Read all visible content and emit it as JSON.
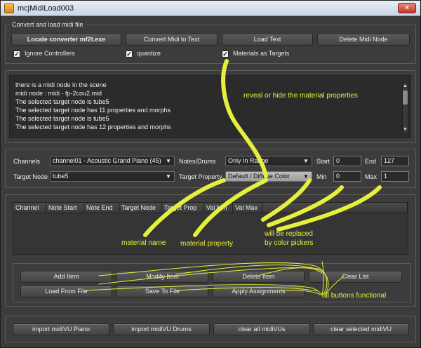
{
  "window": {
    "title": "mcjMidiLoad003",
    "close_glyph": "×"
  },
  "load_group": {
    "label": "Convert and load midi file",
    "buttons": [
      "Locate converter mf2t.exe",
      "Convert Midi to Text",
      "Load Text",
      "Delete Midi Node"
    ],
    "checkboxes": [
      {
        "label": "Ignore Controllers",
        "checked": true
      },
      {
        "label": "quantize",
        "checked": true
      },
      {
        "label": "Materials as Targets",
        "checked": true
      }
    ]
  },
  "log": {
    "lines": [
      "there is a midi node in the scene",
      "midi node : midi - fp-2cou2.mid",
      "The selected target node is tube5",
      "The selected target node has 11 properties and morphs",
      "The selected target node is tube5",
      "The selected target node has 12 properties and morphs"
    ]
  },
  "settings": {
    "channels_label": "Channels",
    "channels_value": "channel01 - Acoustic Grand Piano (45)",
    "notes_label": "Notes/Drums",
    "notes_value": "Only In Range",
    "start_label": "Start",
    "start_value": "0",
    "end_label": "End",
    "end_value": "127",
    "target_node_label": "Target Node",
    "target_node_value": "tube5",
    "target_property_label": "Target Property",
    "target_property_value": "Default / Diffuse Color",
    "min_label": "Min",
    "min_value": "0",
    "max_label": "Max",
    "max_value": "1"
  },
  "table": {
    "columns": [
      "Channel",
      "Note Start",
      "Note End",
      "Target Node",
      "Target Prop",
      "Val Min",
      "Val Max"
    ]
  },
  "actions": {
    "row1": [
      "Add Item",
      "Modify Item",
      "Delete Item",
      "Clear List"
    ],
    "row2": [
      "Load From File",
      "Save To File",
      "Apply Assignments"
    ]
  },
  "midivu": {
    "buttons": [
      "import midiVU Piano",
      "import midiVU Drums",
      "clear all midiVUs",
      "clear selected midiVU"
    ]
  },
  "annotations": {
    "reveal": "reveal or hide the material properties",
    "material_name": "material name",
    "material_property": "material property",
    "replaced_1": "will be replaced",
    "replaced_2": "by color pickers",
    "all_buttons": "all buttons functional"
  }
}
